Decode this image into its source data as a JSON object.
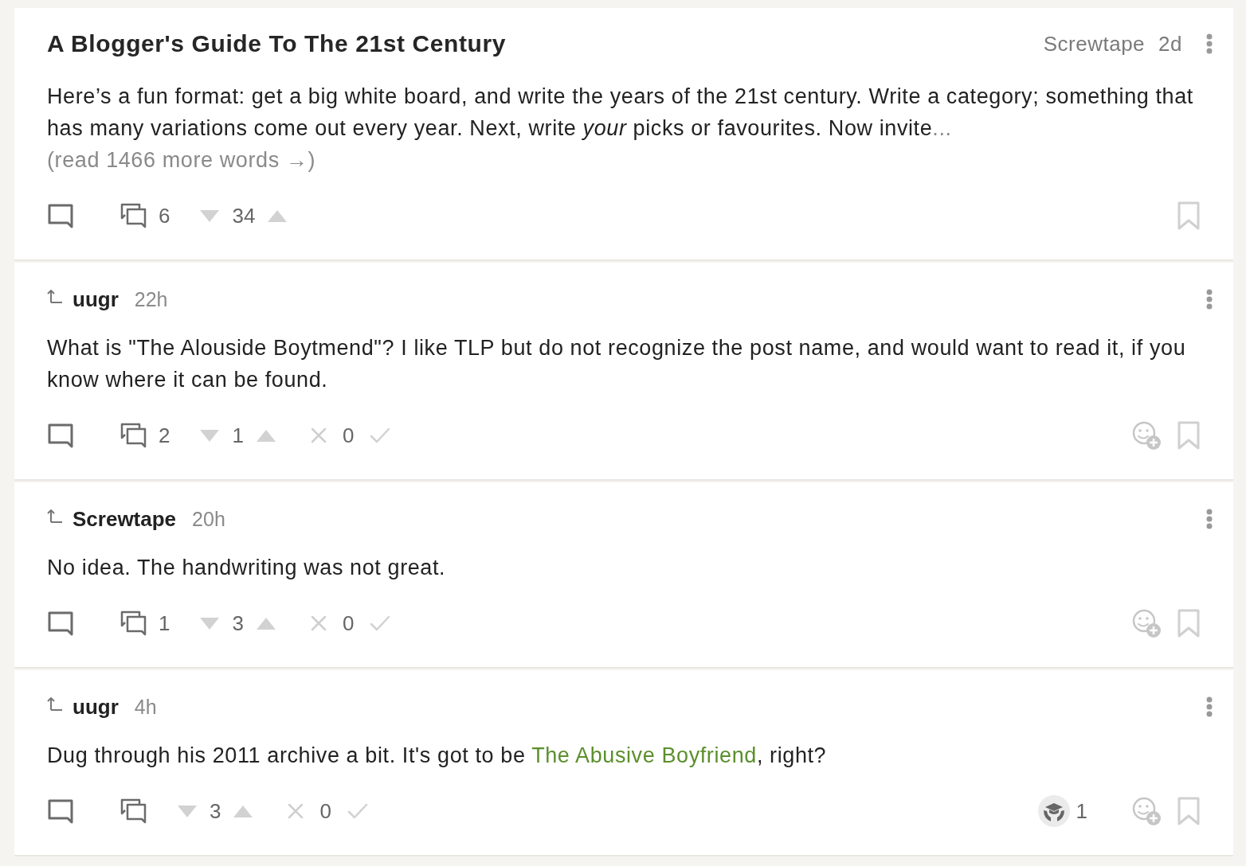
{
  "post": {
    "title": "A Blogger's Guide To The 21st Century",
    "author": "Screwtape",
    "age": "2d",
    "excerpt": "Here’s a fun format: get a big white board, and write the years of the 21st century. Write a category; something that has many variations come out every year. Next, write *your* picks or favourites. Now invite",
    "ellipsis": "...",
    "read_more": "(read 1466 more words →)",
    "comment_count": "6",
    "score": "34"
  },
  "comments": [
    {
      "author": "uugr",
      "age": "22h",
      "body": [
        {
          "kind": "text",
          "text": "What is \"The Alouside Boytmend\"? I like TLP but do not recognize the post name, and would want to read it, if you know where it can be found."
        }
      ],
      "reply_count": "2",
      "score": "1",
      "agreement": "0"
    },
    {
      "author": "Screwtape",
      "age": "20h",
      "body": [
        {
          "kind": "text",
          "text": "No idea. The handwriting was not great."
        }
      ],
      "reply_count": "1",
      "score": "3",
      "agreement": "0"
    },
    {
      "author": "uugr",
      "age": "4h",
      "body": [
        {
          "kind": "text",
          "text": "Dug through his 2011 archive a bit. It's got to be "
        },
        {
          "kind": "link",
          "text": "The Abusive Boyfriend"
        },
        {
          "kind": "text",
          "text": ", right?"
        }
      ],
      "score": "3",
      "agreement": "0",
      "reactions": [
        {
          "kind": "mortarboard",
          "count": "1"
        }
      ]
    }
  ]
}
